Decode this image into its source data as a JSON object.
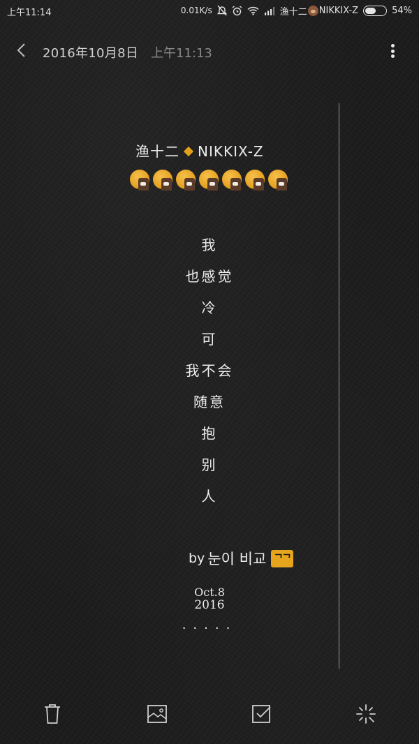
{
  "status_bar": {
    "time": "上午11:14",
    "net_speed": "0.01K/s",
    "notification_text": "渔十二",
    "notification_text2": "NIKKIX-Z",
    "battery_percent": "54%",
    "battery_level": 0.54
  },
  "header": {
    "date": "2016年10月8日",
    "time": "上午11:13"
  },
  "note": {
    "title_left": "渔十二",
    "title_right": "NIKKIX-Z",
    "emoji_count": 7,
    "poem": [
      "我",
      "也感觉",
      "冷",
      "可",
      "我不会",
      "随意",
      "抱",
      "别",
      "人"
    ],
    "signature_by": "by",
    "signature_name": "눈이 비교",
    "signature_badge": "ᄀᄀ",
    "date_month": "Oct.8",
    "date_year": "2016",
    "dots": "·····"
  },
  "colors": {
    "background": "#1b1b1b",
    "accent": "#e7a51d",
    "text": "#ececec"
  },
  "toolbar": {
    "icons": [
      "trash-icon",
      "image-icon",
      "checkbox-icon",
      "sparkle-icon"
    ]
  }
}
